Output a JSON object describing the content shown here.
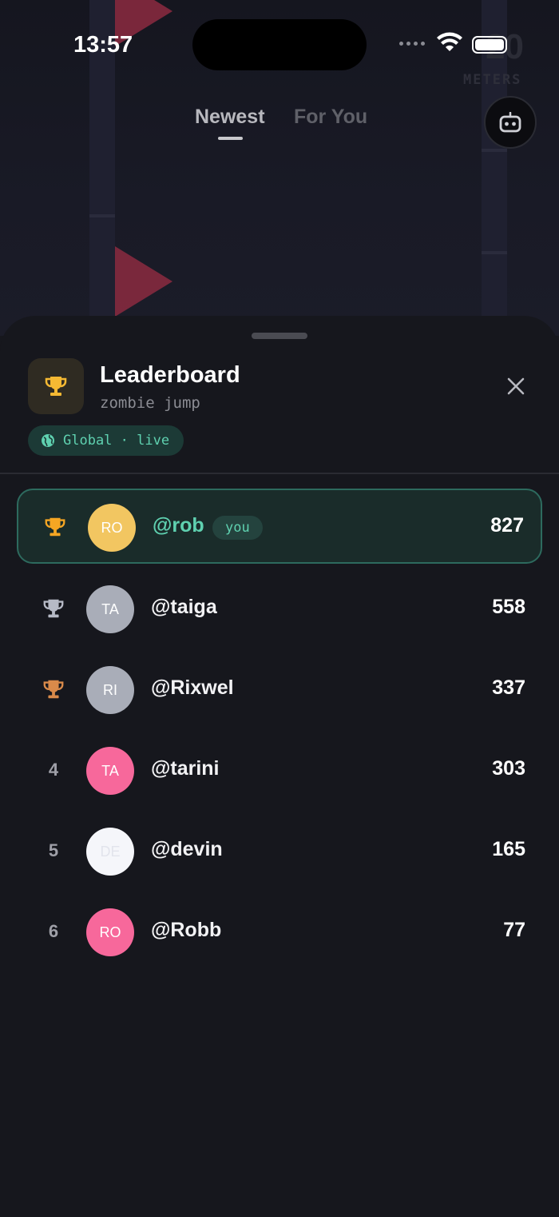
{
  "status_bar": {
    "time": "13:57"
  },
  "game_hud": {
    "meters_value": "20",
    "meters_label": "METERS"
  },
  "feed_tabs": [
    {
      "label": "Newest",
      "active": true
    },
    {
      "label": "For You",
      "active": false
    }
  ],
  "sheet": {
    "title": "Leaderboard",
    "subtitle": "zombie jump",
    "scope_label": "Global · live",
    "accent_color": "#5fd1b0",
    "rows": [
      {
        "rank": "1",
        "trophy": "gold-trophy-icon",
        "initials": "RO",
        "avatar_color": "#f2c661",
        "initials_color": "#ffffff",
        "username": "@rob",
        "you_label": "you",
        "score": "827",
        "is_me": true
      },
      {
        "rank": "2",
        "trophy": "silver-trophy-icon",
        "initials": "TA",
        "avatar_color": "#a9adb8",
        "initials_color": "#ffffff",
        "username": "@taiga",
        "score": "558",
        "is_me": false
      },
      {
        "rank": "3",
        "trophy": "bronze-trophy-icon",
        "initials": "RI",
        "avatar_color": "#a9adb8",
        "initials_color": "#ffffff",
        "username": "@Rixwel",
        "score": "337",
        "is_me": false
      },
      {
        "rank": "4",
        "initials": "TA",
        "avatar_color": "#f7689b",
        "initials_color": "#ffffff",
        "username": "@tarini",
        "score": "303",
        "is_me": false
      },
      {
        "rank": "5",
        "initials": "DE",
        "avatar_color": "#f5f6fa",
        "initials_color": "#e2e4ec",
        "username": "@devin",
        "score": "165",
        "is_me": false
      },
      {
        "rank": "6",
        "initials": "RO",
        "avatar_color": "#f7689b",
        "initials_color": "#ffffff",
        "username": "@Robb",
        "score": "77",
        "is_me": false
      }
    ]
  }
}
